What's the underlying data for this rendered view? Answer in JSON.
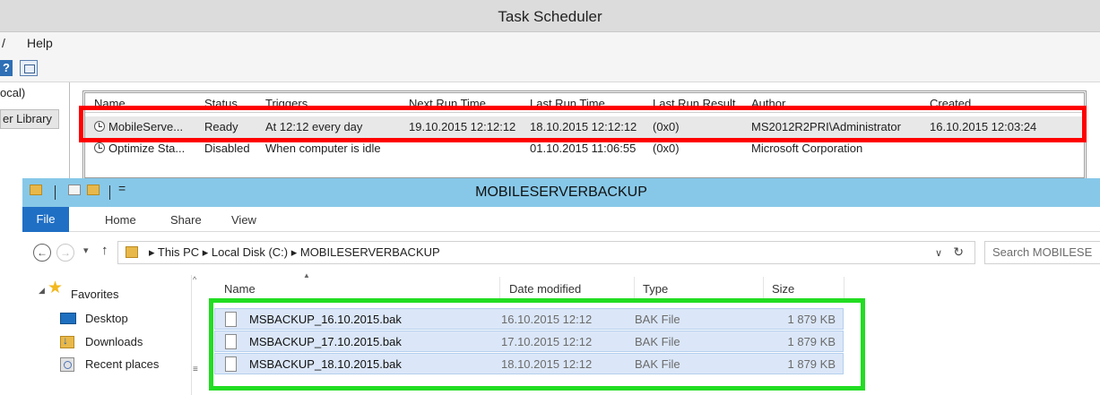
{
  "task_scheduler": {
    "title": "Task Scheduler",
    "menu": {
      "partial_item": "/",
      "help": "Help"
    },
    "toolbar": {
      "help_glyph": "?"
    },
    "tree": {
      "item1": "ocal)",
      "item2": "er Library"
    },
    "columns": [
      "Name",
      "Status",
      "Triggers",
      "Next Run Time",
      "Last Run Time",
      "Last Run Result",
      "Author",
      "Created"
    ],
    "rows": [
      {
        "name": "MobileServe...",
        "status": "Ready",
        "triggers": "At 12:12 every day",
        "next_run": "19.10.2015 12:12:12",
        "last_run": "18.10.2015 12:12:12",
        "result": "(0x0)",
        "author": "MS2012R2PRI\\Administrator",
        "created": "16.10.2015 12:03:24"
      },
      {
        "name": "Optimize Sta...",
        "status": "Disabled",
        "triggers": "When computer is idle",
        "next_run": "",
        "last_run": "01.10.2015 11:06:55",
        "result": "(0x0)",
        "author": "Microsoft Corporation",
        "created": ""
      }
    ]
  },
  "explorer": {
    "title": "MOBILESERVERBACKUP",
    "quick_access_arrow": "=",
    "ribbon_tabs": {
      "file": "File",
      "home": "Home",
      "share": "Share",
      "view": "View"
    },
    "address": {
      "path": "▸ This PC ▸ Local Disk (C:) ▸ MOBILESERVERBACKUP",
      "chevron": "∨",
      "refresh": "↻"
    },
    "nav_glyphs": {
      "back": "←",
      "forward": "→",
      "recent": "▾",
      "up": "↑"
    },
    "search_placeholder": "Search MOBILESE",
    "nav_pane": {
      "favorites": "Favorites",
      "items": [
        "Desktop",
        "Downloads",
        "Recent places"
      ]
    },
    "columns": {
      "name": "Name",
      "date": "Date modified",
      "type": "Type",
      "size": "Size"
    },
    "files": [
      {
        "name": "MSBACKUP_16.10.2015.bak",
        "date": "16.10.2015 12:12",
        "type": "BAK File",
        "size": "1 879 KB"
      },
      {
        "name": "MSBACKUP_17.10.2015.bak",
        "date": "17.10.2015 12:12",
        "type": "BAK File",
        "size": "1 879 KB"
      },
      {
        "name": "MSBACKUP_18.10.2015.bak",
        "date": "18.10.2015 12:12",
        "type": "BAK File",
        "size": "1 879 KB"
      }
    ]
  },
  "colors": {
    "highlight_task": "#ff0000",
    "highlight_files": "#22dd22",
    "explorer_titlebar": "#87c8e8",
    "file_tab": "#1f6fc5"
  }
}
